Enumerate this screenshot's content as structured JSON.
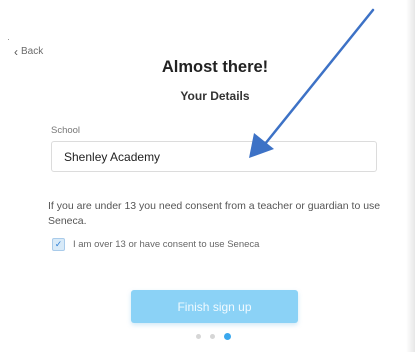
{
  "nav": {
    "back_label": "Back"
  },
  "header": {
    "title": "Almost there!",
    "subtitle": "Your Details"
  },
  "form": {
    "school_label": "School",
    "school_value": "Shenley Academy",
    "consent_text": "If you are under 13 you need consent from a teacher or guardian to use Seneca.",
    "checkbox_label": "I am over 13 or have consent to use Seneca",
    "checkbox_checked": true,
    "submit_label": "Finish sign up"
  },
  "pagination": {
    "total_steps": 3,
    "current_step": 3
  },
  "colors": {
    "button_bg": "#8bd2f6",
    "active_dot": "#3aa8ee",
    "arrow": "#3d72c6",
    "checkbox_bg": "#d8eaf8"
  },
  "icons": {
    "back": "chevron-left-icon",
    "check": "check-icon"
  }
}
